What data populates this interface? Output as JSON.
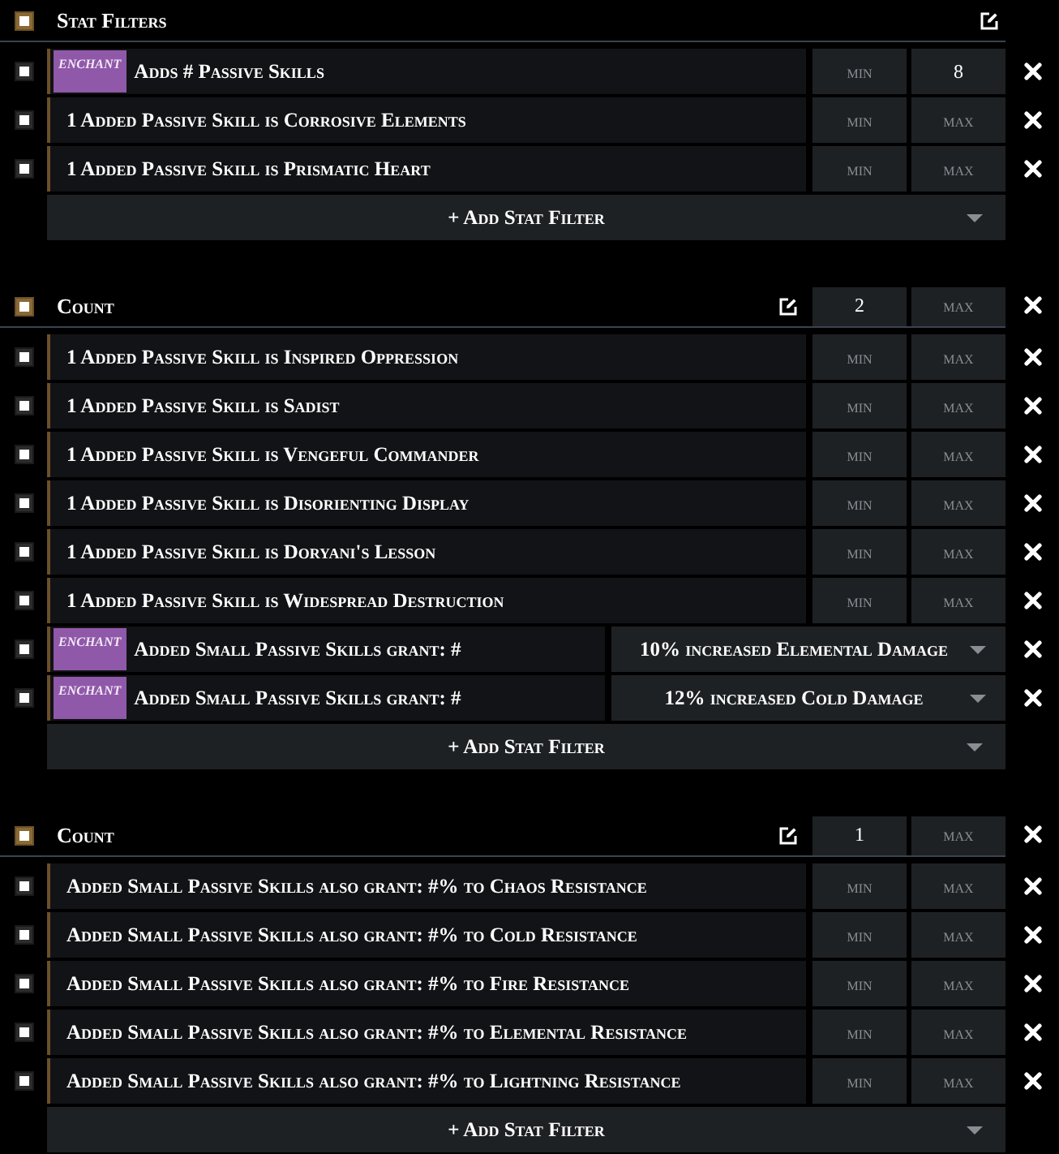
{
  "groups": [
    {
      "kind": "and",
      "title": "Stat Filters",
      "checked": true,
      "filters": [
        {
          "kind": "range",
          "checked": true,
          "badge": "enchant",
          "text": "Adds # Passive Skills",
          "min": {
            "placeholder": "min"
          },
          "max": {
            "value": "8"
          }
        },
        {
          "kind": "range",
          "checked": true,
          "text": "1 Added Passive Skill is Corrosive Elements",
          "min": {
            "placeholder": "min"
          },
          "max": {
            "placeholder": "max"
          }
        },
        {
          "kind": "range",
          "checked": true,
          "text": "1 Added Passive Skill is Prismatic Heart",
          "min": {
            "placeholder": "min"
          },
          "max": {
            "placeholder": "max"
          }
        }
      ],
      "add_button": "+ Add Stat Filter"
    },
    {
      "kind": "count",
      "title": "Count",
      "checked": true,
      "min": {
        "value": "2"
      },
      "max": {
        "placeholder": "max"
      },
      "filters": [
        {
          "kind": "range",
          "checked": true,
          "text": "1 Added Passive Skill is Inspired Oppression",
          "min": {
            "placeholder": "min"
          },
          "max": {
            "placeholder": "max"
          }
        },
        {
          "kind": "range",
          "checked": true,
          "text": "1 Added Passive Skill is Sadist",
          "min": {
            "placeholder": "min"
          },
          "max": {
            "placeholder": "max"
          }
        },
        {
          "kind": "range",
          "checked": true,
          "text": "1 Added Passive Skill is Vengeful Commander",
          "min": {
            "placeholder": "min"
          },
          "max": {
            "placeholder": "max"
          }
        },
        {
          "kind": "range",
          "checked": true,
          "text": "1 Added Passive Skill is Disorienting Display",
          "min": {
            "placeholder": "min"
          },
          "max": {
            "placeholder": "max"
          }
        },
        {
          "kind": "range",
          "checked": true,
          "text": "1 Added Passive Skill is Doryani's Lesson",
          "min": {
            "placeholder": "min"
          },
          "max": {
            "placeholder": "max"
          }
        },
        {
          "kind": "range",
          "checked": true,
          "text": "1 Added Passive Skill is Widespread Destruction",
          "min": {
            "placeholder": "min"
          },
          "max": {
            "placeholder": "max"
          }
        },
        {
          "kind": "option",
          "checked": true,
          "badge": "enchant",
          "text": "Added Small Passive Skills grant: #",
          "option": "10% increased Elemental Damage"
        },
        {
          "kind": "option",
          "checked": true,
          "badge": "enchant",
          "text": "Added Small Passive Skills grant: #",
          "option": "12% increased Cold Damage"
        }
      ],
      "add_button": "+ Add Stat Filter"
    },
    {
      "kind": "count",
      "title": "Count",
      "checked": true,
      "min": {
        "value": "1"
      },
      "max": {
        "placeholder": "max"
      },
      "filters": [
        {
          "kind": "range",
          "checked": true,
          "text": "Added Small Passive Skills also grant: #% to Chaos Resistance",
          "min": {
            "placeholder": "min"
          },
          "max": {
            "placeholder": "max"
          }
        },
        {
          "kind": "range",
          "checked": true,
          "text": "Added Small Passive Skills also grant: #% to Cold Resistance",
          "min": {
            "placeholder": "min"
          },
          "max": {
            "placeholder": "max"
          }
        },
        {
          "kind": "range",
          "checked": true,
          "text": "Added Small Passive Skills also grant: #% to Fire Resistance",
          "min": {
            "placeholder": "min"
          },
          "max": {
            "placeholder": "max"
          }
        },
        {
          "kind": "range",
          "checked": true,
          "text": "Added Small Passive Skills also grant: #% to Elemental Resistance",
          "min": {
            "placeholder": "min"
          },
          "max": {
            "placeholder": "max"
          }
        },
        {
          "kind": "range",
          "checked": true,
          "text": "Added Small Passive Skills also grant: #% to Lightning Resistance",
          "min": {
            "placeholder": "min"
          },
          "max": {
            "placeholder": "max"
          }
        }
      ],
      "add_button": "+ Add Stat Filter"
    }
  ]
}
